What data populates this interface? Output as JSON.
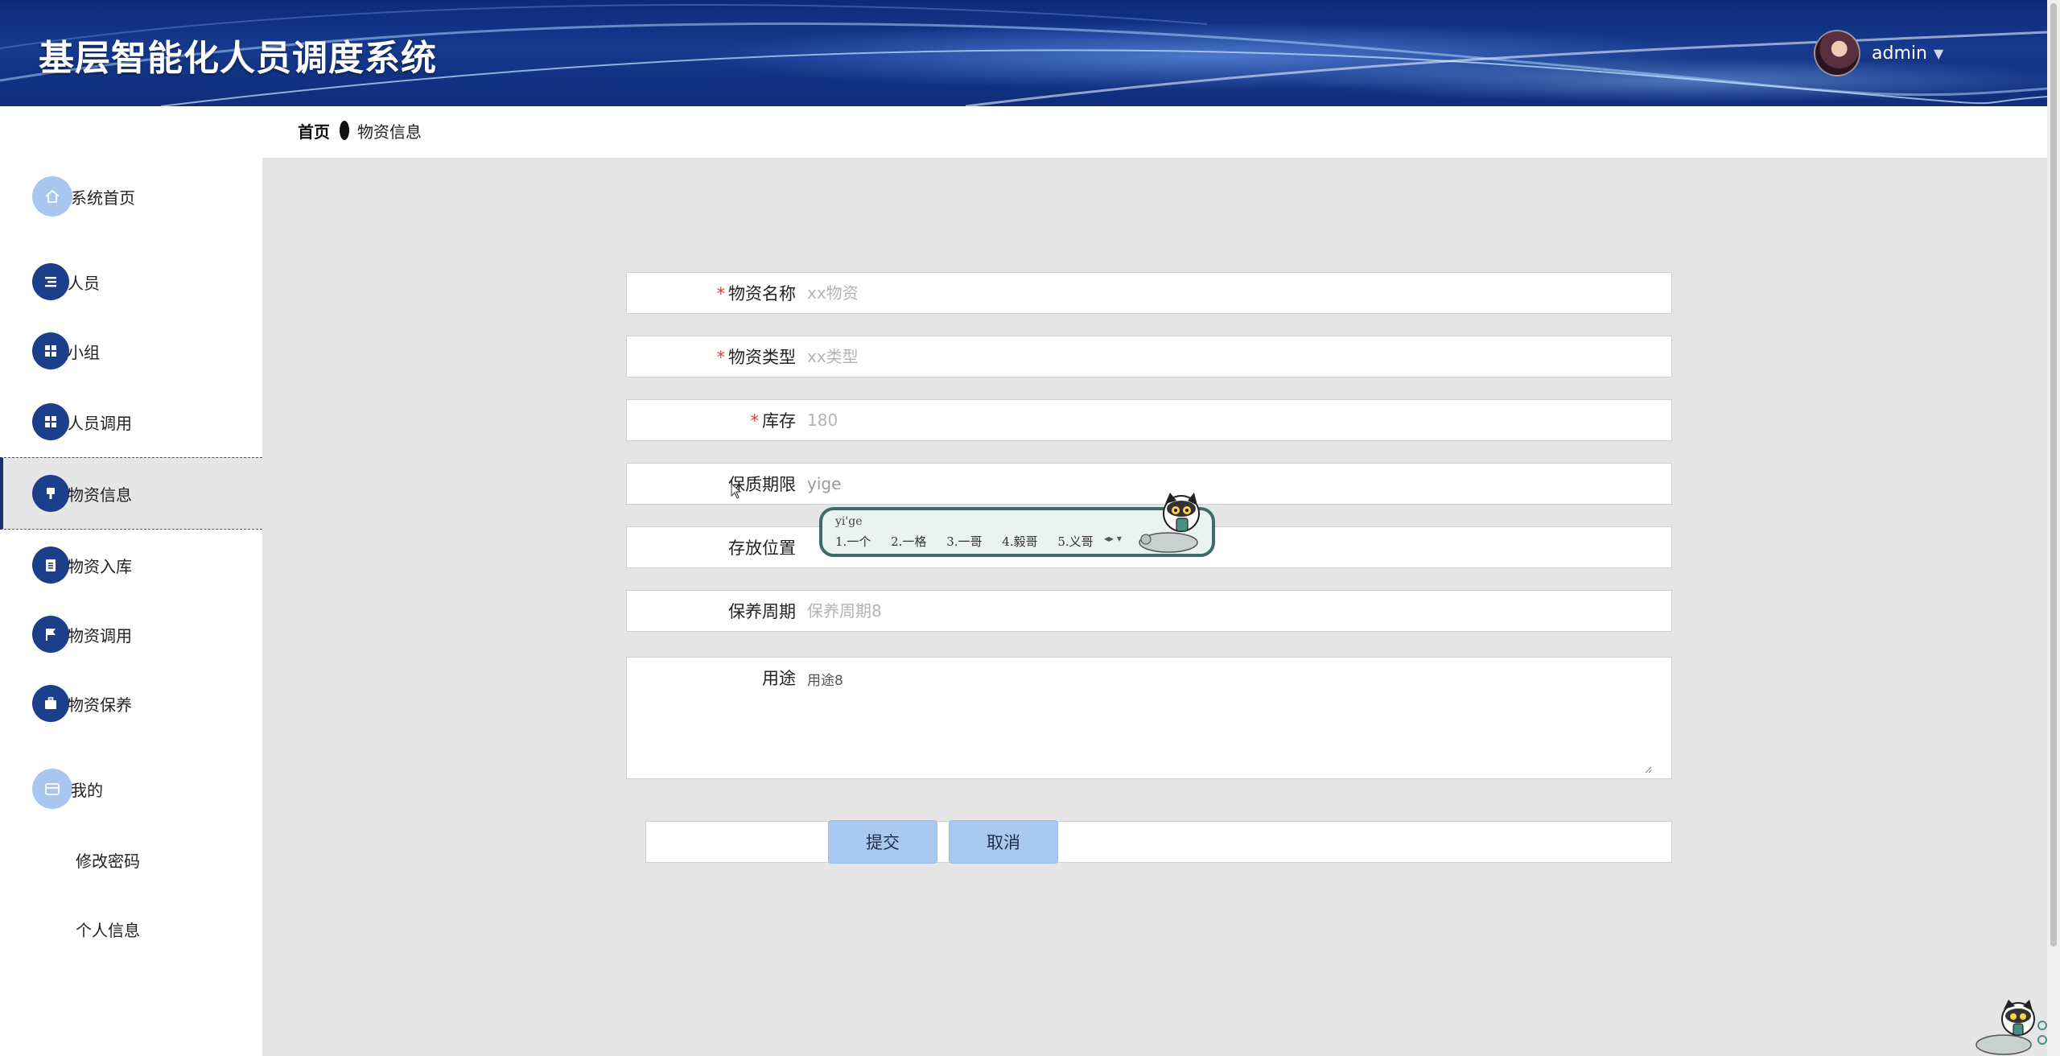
{
  "header": {
    "title": "基层智能化人员调度系统",
    "user_name": "admin",
    "caret": "▼"
  },
  "sidebar": {
    "items": [
      {
        "label": "系统首页",
        "icon": "home-icon"
      },
      {
        "label": "人员",
        "icon": "list-icon"
      },
      {
        "label": "小组",
        "icon": "grid-icon"
      },
      {
        "label": "人员调用",
        "icon": "grid-icon"
      },
      {
        "label": "物资信息",
        "icon": "brush-icon"
      },
      {
        "label": "物资入库",
        "icon": "clipboard-icon"
      },
      {
        "label": "物资调用",
        "icon": "flag-icon"
      },
      {
        "label": "物资保养",
        "icon": "briefcase-icon"
      },
      {
        "label": "我的",
        "icon": "wallet-icon"
      }
    ],
    "sub_items": [
      "修改密码",
      "个人信息"
    ]
  },
  "breadcrumb": {
    "home": "首页",
    "current": "物资信息"
  },
  "form": {
    "fields": [
      {
        "label": "物资名称",
        "required": true,
        "placeholder": "xx物资",
        "value": ""
      },
      {
        "label": "物资类型",
        "required": true,
        "placeholder": "xx类型",
        "value": ""
      },
      {
        "label": "库存",
        "required": true,
        "placeholder": "180",
        "value": ""
      },
      {
        "label": "保质期限",
        "required": false,
        "placeholder": "",
        "value": "yige"
      },
      {
        "label": "存放位置",
        "required": false,
        "placeholder": "",
        "value": ""
      },
      {
        "label": "保养周期",
        "required": false,
        "placeholder": "保养周期8",
        "value": ""
      },
      {
        "label": "用途",
        "required": false,
        "placeholder": "",
        "value": "用途8"
      }
    ],
    "submit_label": "提交",
    "cancel_label": "取消"
  },
  "ime": {
    "composition": "yi'ge",
    "candidates": [
      "1.一个",
      "2.一格",
      "3.一哥",
      "4.毅哥",
      "5.义哥"
    ]
  },
  "colors": {
    "header": "#163a8e",
    "icon_bg": "#1c3f8c",
    "button": "#a9c8ef",
    "content_bg": "#e5e5e5"
  }
}
